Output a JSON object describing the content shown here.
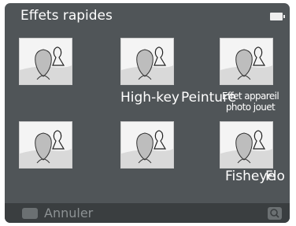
{
  "header": {
    "title": "Effets rapides"
  },
  "status": {
    "battery_icon": "battery-full-icon"
  },
  "effects": [
    {
      "labels": []
    },
    {
      "labels": [
        "High-key",
        "Peinture"
      ]
    },
    {
      "labels": [
        "Effet appareil photo jouet"
      ]
    },
    {
      "labels": []
    },
    {
      "labels": []
    },
    {
      "labels": [
        "Fisheye",
        "Flo"
      ]
    }
  ],
  "footer": {
    "cancel_label": "Annuler",
    "cancel_icon": "menu-button-icon",
    "zoom_icon": "zoom-icon"
  }
}
